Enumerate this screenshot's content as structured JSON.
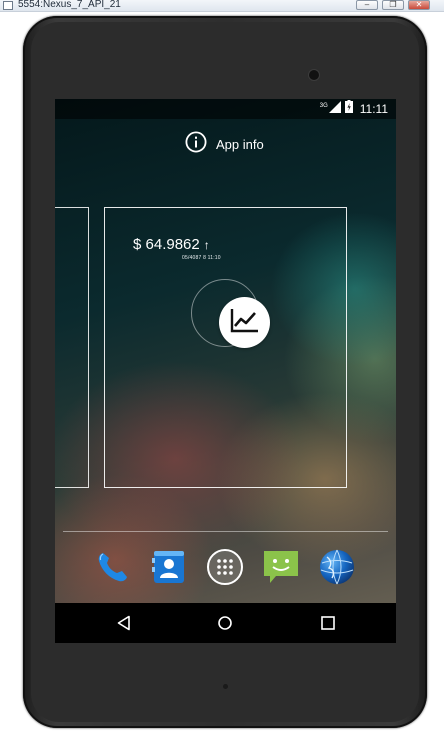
{
  "window": {
    "title": "5554:Nexus_7_API_21",
    "minimize_glyph": "–",
    "restore_glyph": "❐",
    "close_glyph": "✕"
  },
  "status_bar": {
    "network_label": "3G",
    "time": "11:11",
    "icons": [
      "signal-icon",
      "battery-charging-icon"
    ]
  },
  "app_info": {
    "label": "App info",
    "icon": "info-icon"
  },
  "widget": {
    "price": "$ 64.9862",
    "trend_arrow": "↑",
    "timestamp": "05/4087 8 11:10",
    "action_icon": "chart-line-icon"
  },
  "dock": {
    "apps": [
      {
        "name": "Phone",
        "icon": "phone-icon"
      },
      {
        "name": "Contacts",
        "icon": "contacts-icon"
      },
      {
        "name": "Apps",
        "icon": "app-drawer-icon"
      },
      {
        "name": "Messaging",
        "icon": "messaging-icon"
      },
      {
        "name": "Browser",
        "icon": "browser-globe-icon"
      }
    ]
  },
  "nav": {
    "buttons": [
      "back-icon",
      "home-icon",
      "recents-icon"
    ]
  },
  "colors": {
    "phone_blue": "#1e88e5",
    "contacts_blue": "#1976d2",
    "messaging_green": "#8bc34a",
    "globe_blue": "#1565c0"
  }
}
